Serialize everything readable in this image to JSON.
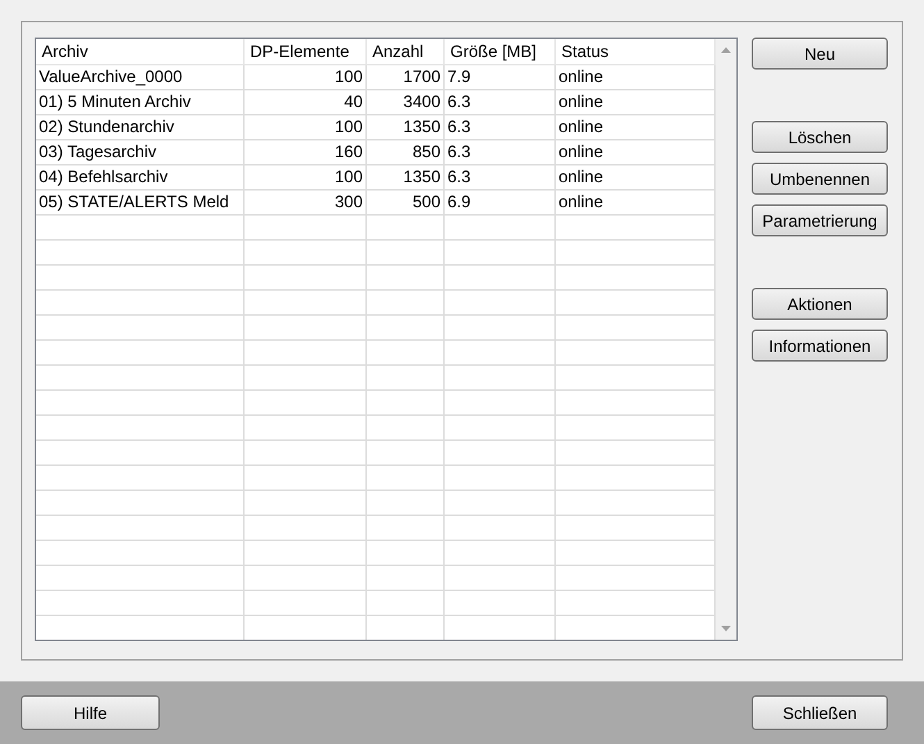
{
  "table": {
    "columns": [
      "Archiv",
      "DP-Elemente",
      "Anzahl",
      "Größe [MB]",
      "Status"
    ],
    "rows": [
      [
        "ValueArchive_0000",
        "100",
        "1700",
        "7.9",
        "online"
      ],
      [
        "01) 5 Minuten Archiv",
        "40",
        "3400",
        "6.3",
        "online"
      ],
      [
        "02) Stundenarchiv",
        "100",
        "1350",
        "6.3",
        "online"
      ],
      [
        "03) Tagesarchiv",
        "160",
        "850",
        "6.3",
        "online"
      ],
      [
        "04) Befehlsarchiv",
        "100",
        "1350",
        "6.3",
        "online"
      ],
      [
        "05) STATE/ALERTS Meld",
        "300",
        "500",
        "6.9",
        "online"
      ]
    ]
  },
  "side_buttons": [
    {
      "buttons": [
        "Neu"
      ]
    },
    {
      "buttons": [
        "Löschen",
        "Umbenennen",
        "Parametrierung"
      ]
    },
    {
      "buttons": [
        "Aktionen",
        "Informationen"
      ]
    }
  ],
  "footer": {
    "left_button": "Hilfe",
    "right_button": "Schließen"
  }
}
